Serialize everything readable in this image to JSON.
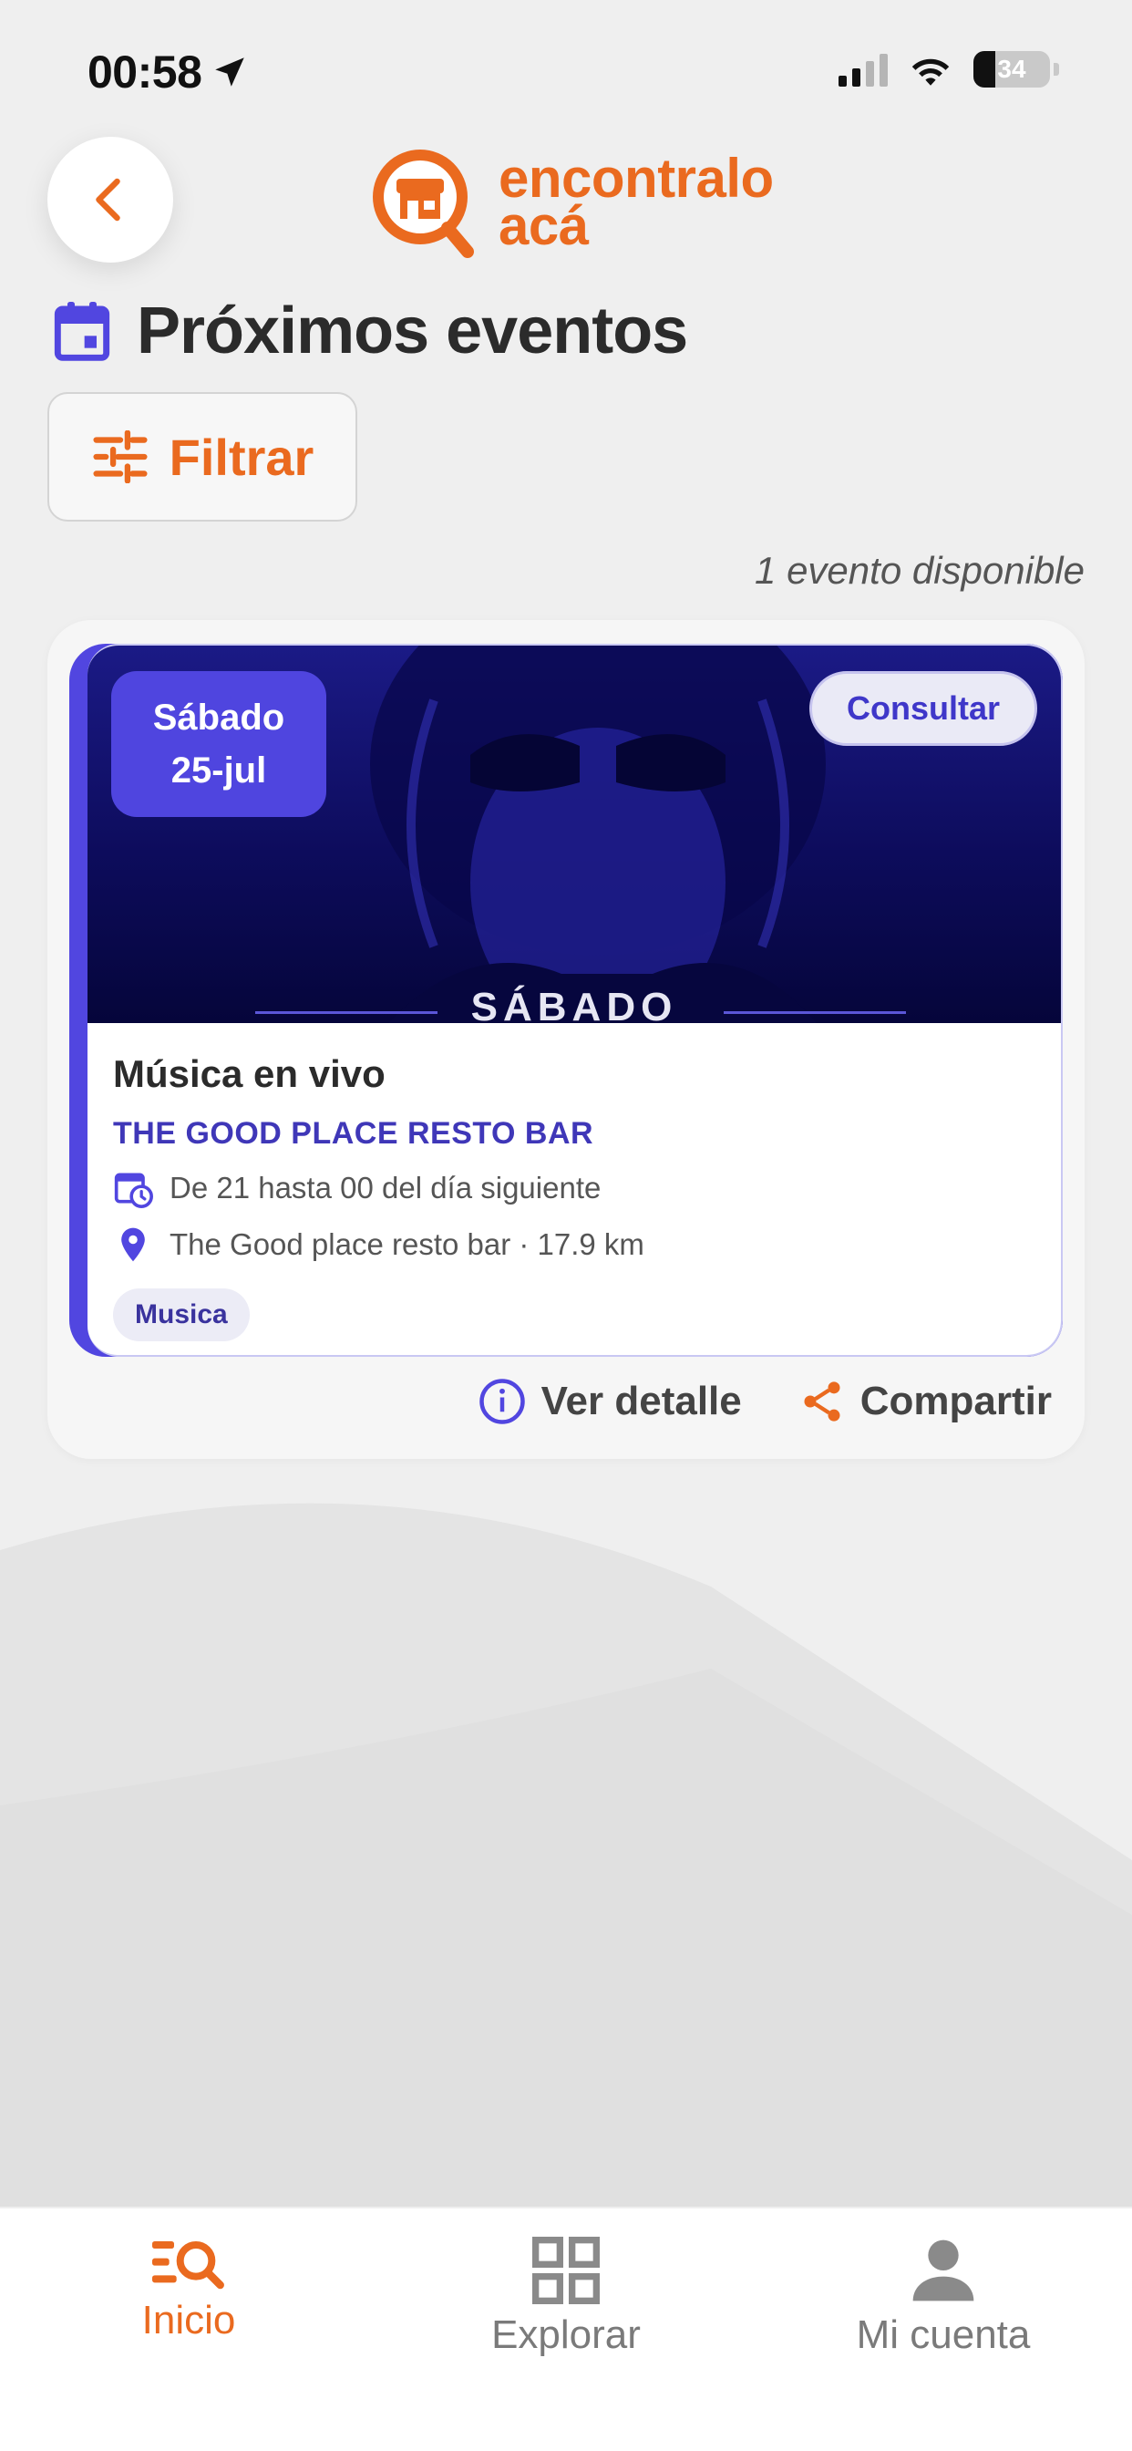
{
  "status_bar": {
    "time": "00:58",
    "battery": "34"
  },
  "header": {
    "logo_line1": "encontralo",
    "logo_line2": "acá"
  },
  "page": {
    "title": "Próximos eventos",
    "filter_label": "Filtrar",
    "count_text": "1 evento disponible"
  },
  "event": {
    "day": "Sábado",
    "date": "25-jul",
    "consult_label": "Consultar",
    "image_caption": "SÁBADO",
    "name": "Música en vivo",
    "venue": "THE GOOD PLACE RESTO BAR",
    "schedule": "De 21 hasta 00 del día siguiente",
    "location": "The Good place resto bar · 17.9 km",
    "tag": "Musica",
    "detail_label": "Ver detalle",
    "share_label": "Compartir"
  },
  "nav": {
    "items": [
      {
        "label": "Inicio"
      },
      {
        "label": "Explorar"
      },
      {
        "label": "Mi cuenta"
      }
    ]
  },
  "colors": {
    "brand_orange": "#ea6a1f",
    "accent_purple": "#5146e0"
  },
  "icons": [
    "location-arrow-icon",
    "signal-icon",
    "wifi-icon",
    "battery-icon",
    "back-chevron-icon",
    "logo-store-icon",
    "calendar-icon",
    "filter-icon",
    "calendar-clock-icon",
    "map-pin-icon",
    "info-icon",
    "share-icon",
    "home-search-icon",
    "grid-icon",
    "person-icon"
  ]
}
